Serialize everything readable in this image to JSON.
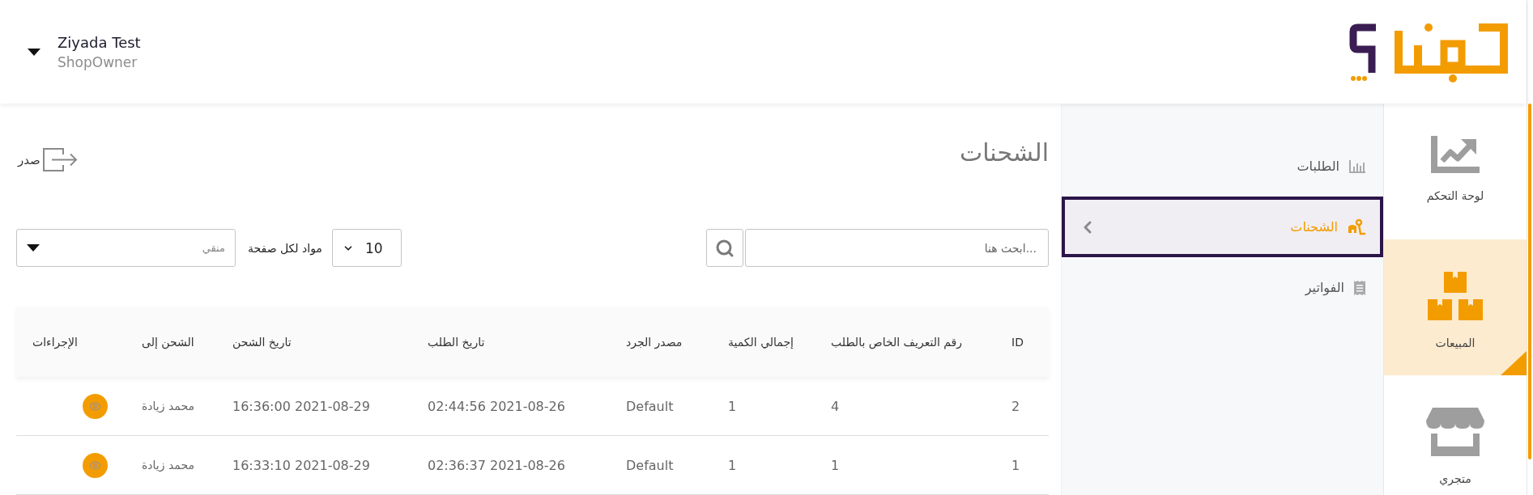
{
  "header": {
    "user_name": "Ziyada Test",
    "user_role": "ShopOwner"
  },
  "sidebar": {
    "items": [
      {
        "label": "لوحة التحكم",
        "selected": false
      },
      {
        "label": "المبيعات",
        "selected": true
      },
      {
        "label": "متجري",
        "selected": false
      }
    ]
  },
  "subnav": {
    "items": [
      {
        "label": "الطلبات",
        "selected": false
      },
      {
        "label": "الشحنات",
        "selected": true
      },
      {
        "label": "الفواتير",
        "selected": false
      }
    ]
  },
  "page": {
    "title": "الشحنات",
    "export_label": "صدر"
  },
  "toolbar": {
    "search": {
      "placeholder": "ابحث هنا..."
    },
    "per_page": {
      "label": "مواد لكل صفحة",
      "value": "10"
    },
    "filter": {
      "placeholder": "منقي"
    }
  },
  "table": {
    "columns": [
      "ID",
      "رقم التعريف الخاص بالطلب",
      "إجمالي الكمية",
      "مصدر الجرد",
      "تاريخ الطلب",
      "تاريخ الشحن",
      "الشحن إلى",
      "الإجراءات"
    ],
    "rows": [
      {
        "cells": [
          "2",
          "4",
          "1",
          "Default",
          "02:44:56 2021-08-26",
          "16:36:00 2021-08-29",
          "محمد زيادة"
        ]
      },
      {
        "cells": [
          "1",
          "1",
          "1",
          "Default",
          "02:36:37 2021-08-26",
          "16:33:10 2021-08-29",
          "محمد زيادة"
        ]
      }
    ]
  }
}
